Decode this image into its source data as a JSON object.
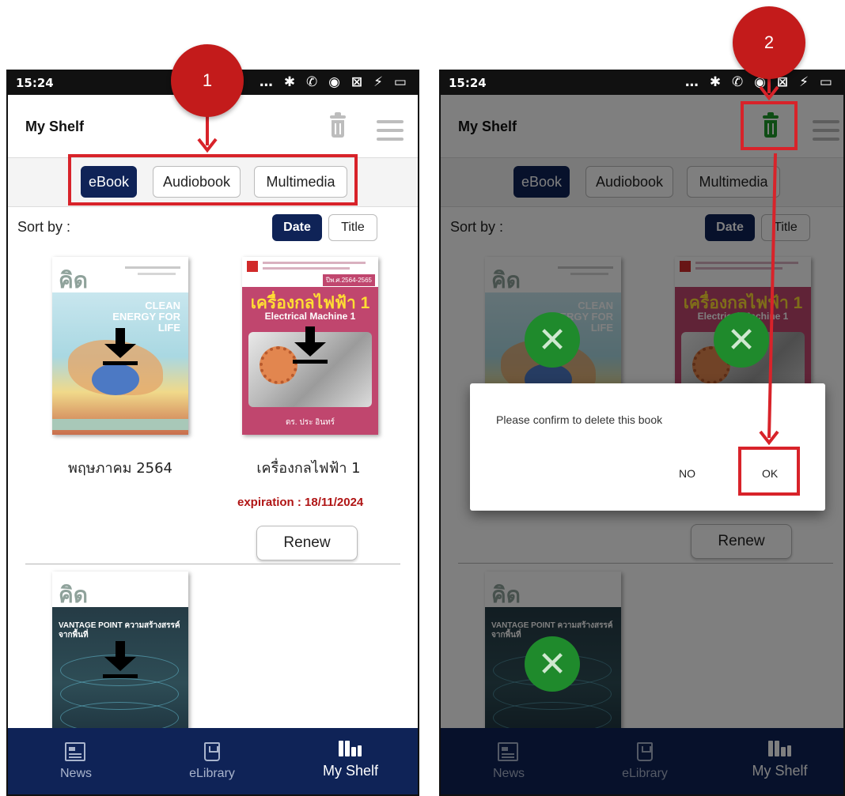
{
  "left_screen": {
    "status_time": "15:24",
    "status_icons": "… ✱ ✆ ◉ ⊠ ⚡ ▭",
    "app_title": "My Shelf",
    "tabs": [
      {
        "label": "eBook",
        "active": true
      },
      {
        "label": "Audiobook",
        "active": false
      },
      {
        "label": "Multimedia",
        "active": false
      }
    ],
    "sort": {
      "label": "Sort by :",
      "options": [
        {
          "label": "Date",
          "active": true
        },
        {
          "label": "Title",
          "active": false
        }
      ]
    },
    "books": [
      {
        "title": "พฤษภาคม 2564",
        "cover_logo": "คิด",
        "cover_caption": "CLEAN ENERGY FOR LIFE",
        "icon": "download-icon"
      },
      {
        "title": "เครื่องกลไฟฟ้า 1",
        "cover_title_th": "เครื่องกลไฟฟ้า 1",
        "cover_title_en": "Electrical Machine 1",
        "cover_author": "ดร. ประ อินทร์",
        "cover_year": "ปีพ.ศ.2564-2565",
        "expiration": "expiration : 18/11/2024",
        "renew_label": "Renew",
        "icon": "download-icon"
      },
      {
        "title": "",
        "cover_logo": "คิด",
        "cover_caption": "VANTAGE POINT ความสร้างสรรค์จากพื้นที่",
        "icon": "download-icon"
      }
    ],
    "nav": [
      {
        "label": "News",
        "icon": "news-icon",
        "active": false
      },
      {
        "label": "eLibrary",
        "icon": "library-icon",
        "active": false
      },
      {
        "label": "My Shelf",
        "icon": "shelf-icon",
        "active": true
      }
    ]
  },
  "right_screen": {
    "status_time": "15:24",
    "status_icons": "… ✱ ✆ ◉ ⊠ ⚡ ▭",
    "app_title": "My Shelf",
    "tabs": [
      {
        "label": "eBook",
        "active": true
      },
      {
        "label": "Audiobook",
        "active": false
      },
      {
        "label": "Multimedia",
        "active": false
      }
    ],
    "sort": {
      "label": "Sort by :",
      "options": [
        {
          "label": "Date",
          "active": true
        },
        {
          "label": "Title",
          "active": false
        }
      ]
    },
    "books": [
      {
        "cover_logo": "คิด",
        "cover_caption": "CLEAN ENERGY FOR LIFE",
        "icon": "delete-x-icon"
      },
      {
        "cover_title_th": "เครื่องกลไฟฟ้า 1",
        "cover_title_en": "Electrical Machine 1",
        "icon": "delete-x-icon",
        "renew_label": "Renew"
      },
      {
        "cover_logo": "คิด",
        "cover_caption": "VANTAGE POINT ความสร้างสรรค์จากพื้นที่",
        "icon": "delete-x-icon"
      }
    ],
    "dialog": {
      "message": "Please confirm to delete this book",
      "no_label": "NO",
      "ok_label": "OK"
    },
    "nav": [
      {
        "label": "News",
        "icon": "news-icon",
        "active": false
      },
      {
        "label": "eLibrary",
        "icon": "library-icon",
        "active": false
      },
      {
        "label": "My Shelf",
        "icon": "shelf-icon",
        "active": true
      }
    ]
  },
  "annotations": {
    "step1_label": "1",
    "step2_label": "2",
    "highlight_color": "#d8232a",
    "badge_color": "#c31b1b"
  },
  "colors": {
    "primary_navy": "#0f2357",
    "expiration_red": "#b01515",
    "trash_active_green": "#1f9a2b",
    "trash_inactive_gray": "#bdbdbd"
  }
}
